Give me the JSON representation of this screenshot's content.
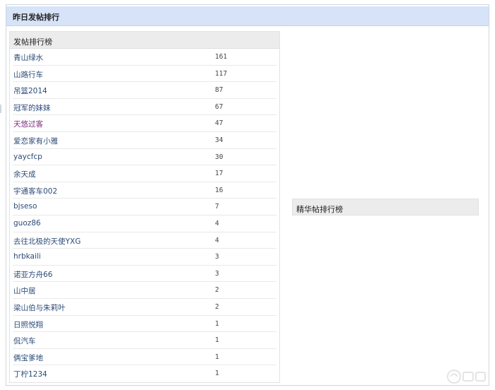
{
  "header": {
    "title": "昨日发帖排行"
  },
  "left_panel": {
    "title": "发帖排行榜",
    "rows": [
      {
        "name": "青山绿水",
        "count": "161"
      },
      {
        "name": "山路行车",
        "count": "117"
      },
      {
        "name": "吊篮2014",
        "count": "87"
      },
      {
        "name": "冠军的妹妹",
        "count": "67"
      },
      {
        "name": "天悠过客",
        "count": "47"
      },
      {
        "name": "爱恋家有小雅",
        "count": "34"
      },
      {
        "name": "yaycfcp",
        "count": "30"
      },
      {
        "name": "余天成",
        "count": "17"
      },
      {
        "name": "宇通客车002",
        "count": "16"
      },
      {
        "name": "bjseso",
        "count": "7"
      },
      {
        "name": "guoz86",
        "count": "4"
      },
      {
        "name": "去往北极的天使YXG",
        "count": "4"
      },
      {
        "name": "hrbkaili",
        "count": "3"
      },
      {
        "name": "诺亚方舟66",
        "count": "3"
      },
      {
        "name": "山中居",
        "count": "2"
      },
      {
        "name": "梁山伯与朱莉叶",
        "count": "2"
      },
      {
        "name": "日照悦翔",
        "count": "1"
      },
      {
        "name": "侃汽车",
        "count": "1"
      },
      {
        "name": "俩宝爹地",
        "count": "1"
      },
      {
        "name": "丁柠1234",
        "count": "1"
      }
    ]
  },
  "right_panel": {
    "title": "精华帖排行榜"
  },
  "watermark": {
    "icon": "site-logo-icon"
  },
  "colors": {
    "header_bg": "#d6e3f8",
    "panel_head_bg": "#ececec",
    "link": "#2b4a78",
    "visited_link": "#7a2a7a"
  }
}
